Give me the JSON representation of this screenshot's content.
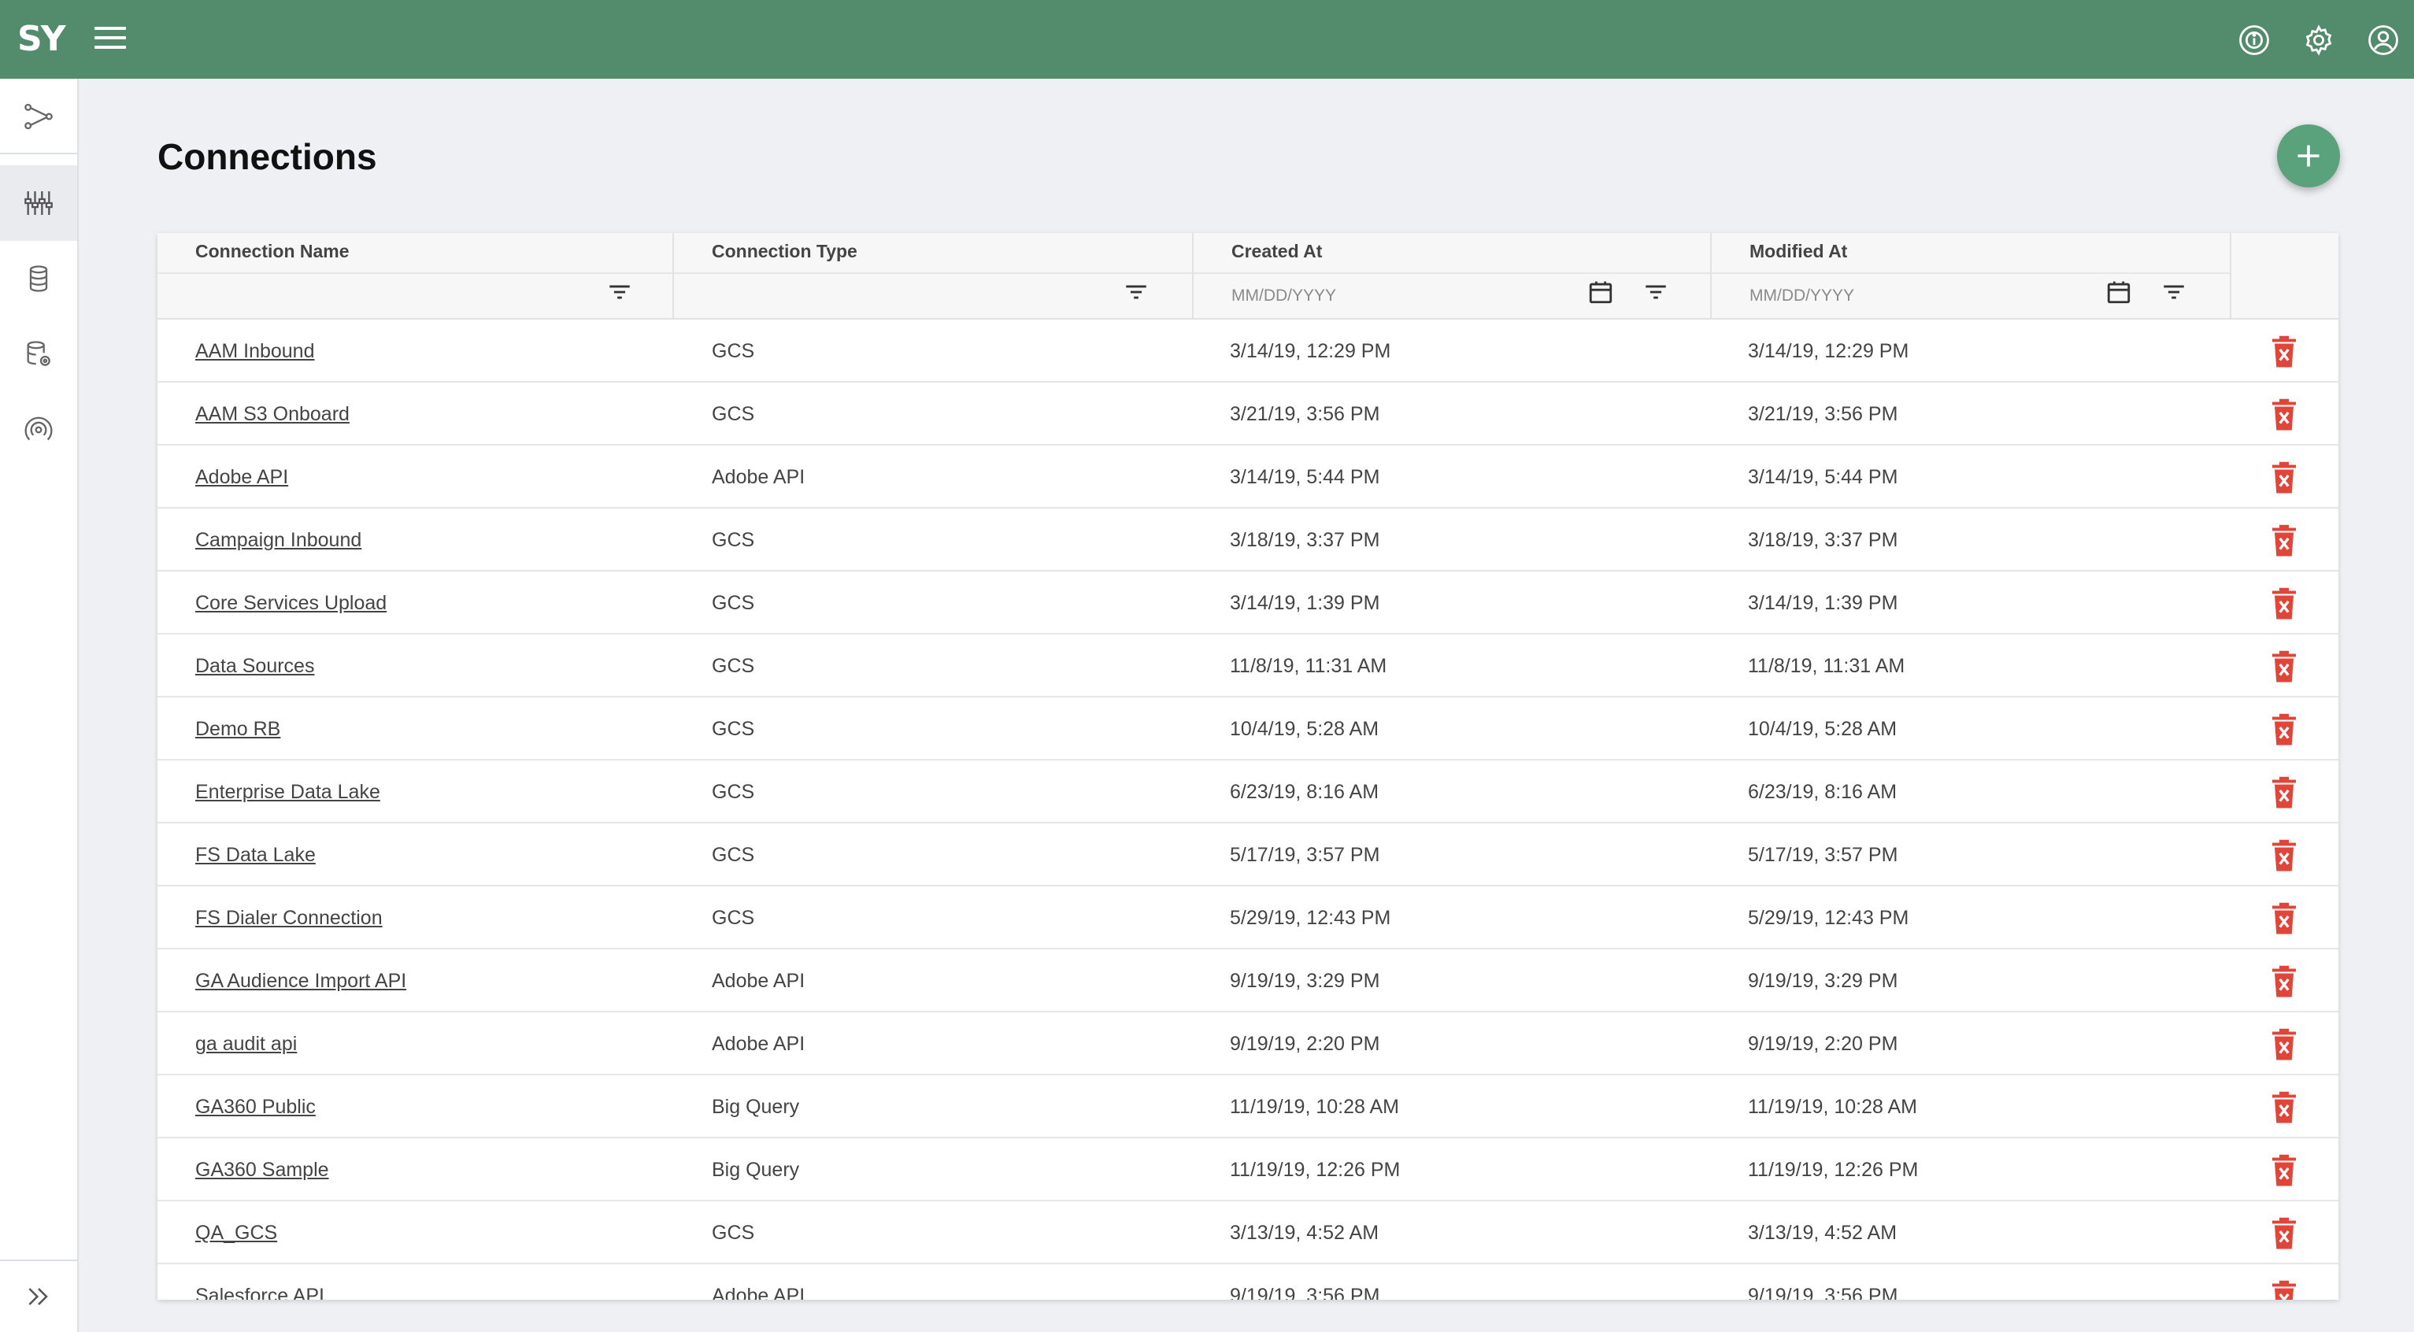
{
  "app": {
    "logo_text": "SY"
  },
  "page": {
    "title": "Connections"
  },
  "table": {
    "columns": [
      {
        "label": "Connection Name",
        "placeholder": ""
      },
      {
        "label": "Connection Type",
        "placeholder": ""
      },
      {
        "label": "Created At",
        "placeholder": "MM/DD/YYYY"
      },
      {
        "label": "Modified At",
        "placeholder": "MM/DD/YYYY"
      }
    ],
    "rows": [
      {
        "name": "AAM Inbound",
        "type": "GCS",
        "created": "3/14/19, 12:29 PM",
        "modified": "3/14/19, 12:29 PM"
      },
      {
        "name": "AAM S3 Onboard",
        "type": "GCS",
        "created": "3/21/19, 3:56 PM",
        "modified": "3/21/19, 3:56 PM"
      },
      {
        "name": "Adobe API",
        "type": "Adobe API",
        "created": "3/14/19, 5:44 PM",
        "modified": "3/14/19, 5:44 PM"
      },
      {
        "name": "Campaign Inbound",
        "type": "GCS",
        "created": "3/18/19, 3:37 PM",
        "modified": "3/18/19, 3:37 PM"
      },
      {
        "name": "Core Services Upload",
        "type": "GCS",
        "created": "3/14/19, 1:39 PM",
        "modified": "3/14/19, 1:39 PM"
      },
      {
        "name": "Data Sources",
        "type": "GCS",
        "created": "11/8/19, 11:31 AM",
        "modified": "11/8/19, 11:31 AM"
      },
      {
        "name": "Demo RB",
        "type": "GCS",
        "created": "10/4/19, 5:28 AM",
        "modified": "10/4/19, 5:28 AM"
      },
      {
        "name": "Enterprise Data Lake",
        "type": "GCS",
        "created": "6/23/19, 8:16 AM",
        "modified": "6/23/19, 8:16 AM"
      },
      {
        "name": "FS Data Lake",
        "type": "GCS",
        "created": "5/17/19, 3:57 PM",
        "modified": "5/17/19, 3:57 PM"
      },
      {
        "name": "FS Dialer Connection",
        "type": "GCS",
        "created": "5/29/19, 12:43 PM",
        "modified": "5/29/19, 12:43 PM"
      },
      {
        "name": "GA Audience Import API",
        "type": "Adobe API",
        "created": "9/19/19, 3:29 PM",
        "modified": "9/19/19, 3:29 PM"
      },
      {
        "name": "ga audit api",
        "type": "Adobe API",
        "created": "9/19/19, 2:20 PM",
        "modified": "9/19/19, 2:20 PM"
      },
      {
        "name": "GA360 Public",
        "type": "Big Query",
        "created": "11/19/19, 10:28 AM",
        "modified": "11/19/19, 10:28 AM"
      },
      {
        "name": "GA360 Sample",
        "type": "Big Query",
        "created": "11/19/19, 12:26 PM",
        "modified": "11/19/19, 12:26 PM"
      },
      {
        "name": "QA_GCS",
        "type": "GCS",
        "created": "3/13/19, 4:52 AM",
        "modified": "3/13/19, 4:52 AM"
      },
      {
        "name": "Salesforce API",
        "type": "Adobe API",
        "created": "9/19/19, 3:56 PM",
        "modified": "9/19/19, 3:56 PM"
      }
    ]
  },
  "colors": {
    "topbar": "#528c6c",
    "fab": "#5aa27c",
    "delete": "#e0453a"
  }
}
